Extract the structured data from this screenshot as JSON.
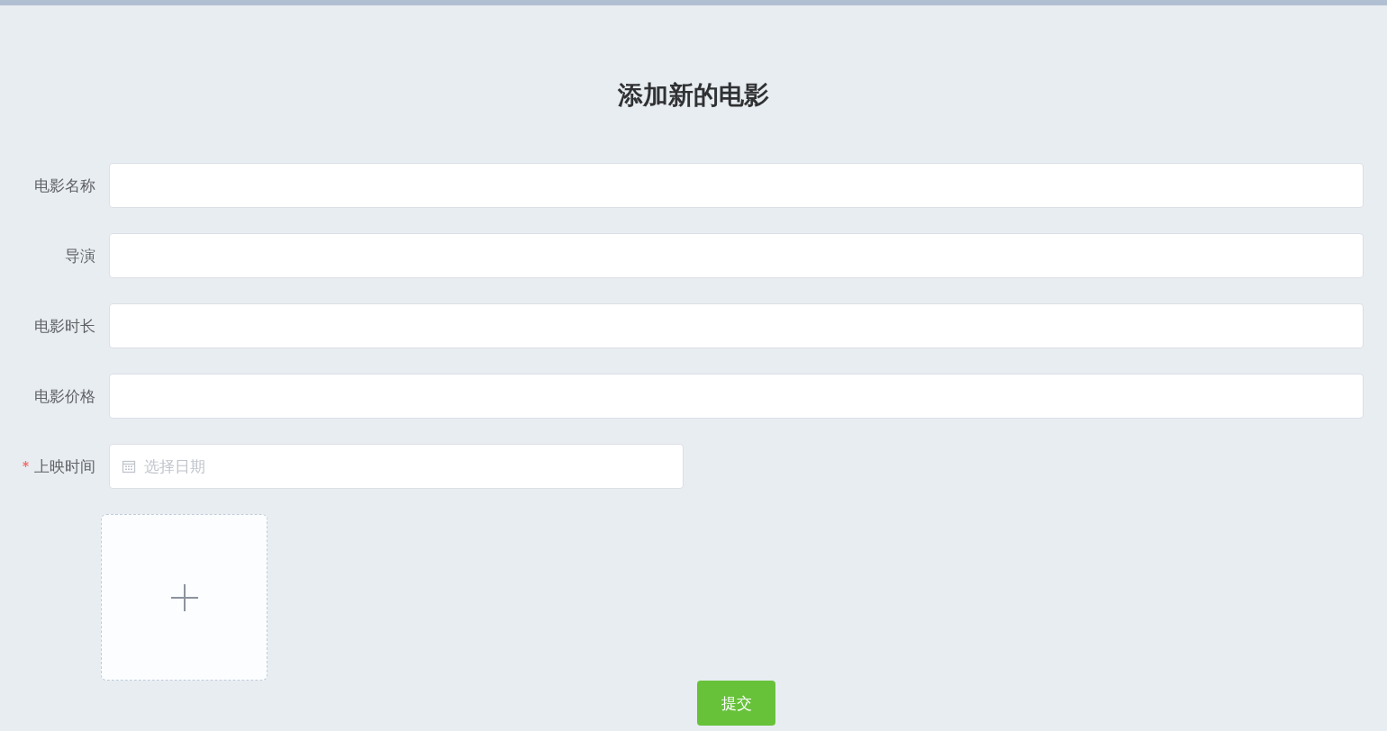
{
  "title": "添加新的电影",
  "fields": [
    {
      "label": "电影名称",
      "kind": "text",
      "required": false
    },
    {
      "label": "导演",
      "kind": "text",
      "required": false
    },
    {
      "label": "电影时长",
      "kind": "text",
      "required": false
    },
    {
      "label": "电影价格",
      "kind": "text",
      "required": false
    },
    {
      "label": "上映时间",
      "kind": "date",
      "required": true,
      "placeholder": "选择日期"
    }
  ],
  "upload": {
    "kind": "picture-card"
  },
  "submit": "提交"
}
